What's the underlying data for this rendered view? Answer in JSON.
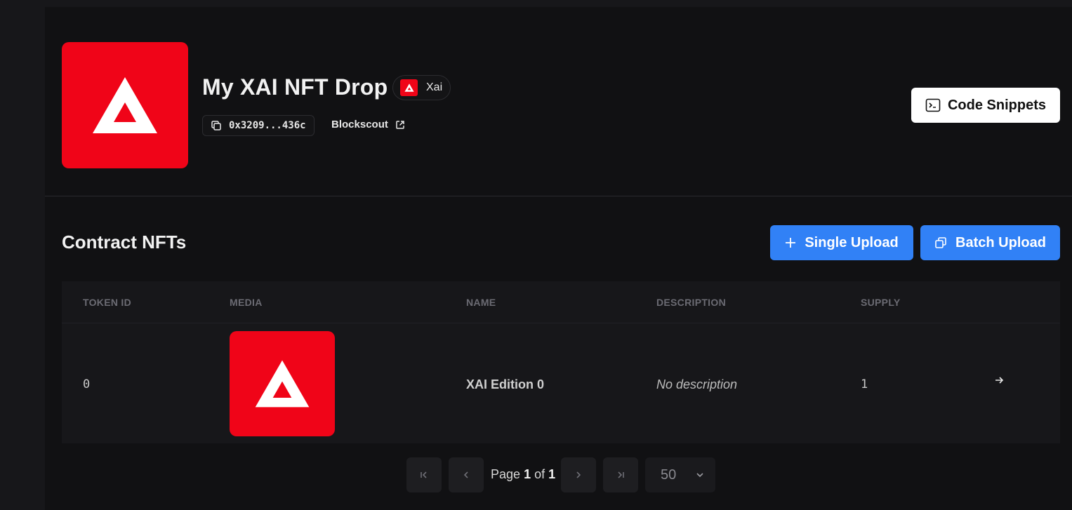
{
  "contract": {
    "name": "My XAI NFT Drop",
    "chain": "Xai",
    "address": "0x3209...436c",
    "explorer": "Blockscout",
    "code_snippets_label": "Code Snippets"
  },
  "nfts": {
    "title": "Contract NFTs",
    "single_upload_label": "Single Upload",
    "batch_upload_label": "Batch Upload",
    "columns": [
      "TOKEN ID",
      "MEDIA",
      "NAME",
      "DESCRIPTION",
      "SUPPLY"
    ],
    "rows": [
      {
        "token_id": "0",
        "name": "XAI Edition 0",
        "description": "No description",
        "supply": "1"
      }
    ]
  },
  "pagination": {
    "page_label": "Page",
    "current": "1",
    "of_label": "of",
    "total": "1",
    "page_size": "50"
  },
  "colors": {
    "brand_red": "#f00418",
    "accent_blue": "#3181f6"
  }
}
